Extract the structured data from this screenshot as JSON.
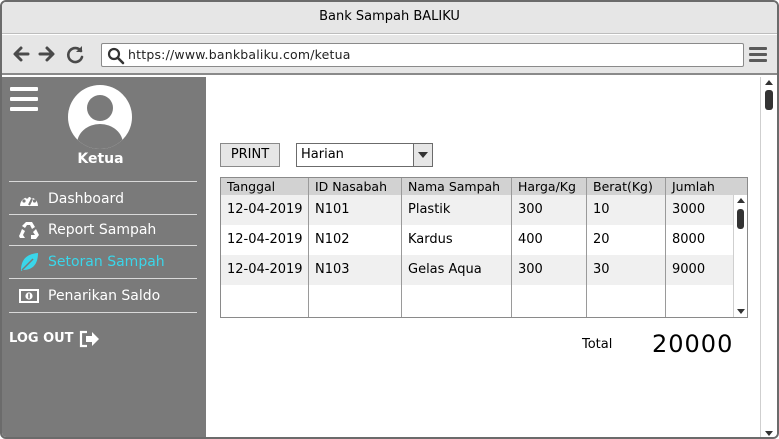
{
  "window": {
    "title": "Bank Sampah BALIKU"
  },
  "browser": {
    "url": "https://www.bankbaliku.com/ketua",
    "back_icon": "arrow-left-icon",
    "forward_icon": "arrow-right-icon",
    "reload_icon": "reload-icon",
    "search_icon": "search-icon",
    "menu_icon": "hamburger-icon"
  },
  "sidebar": {
    "role": "Ketua",
    "items": [
      {
        "label": "Dashboard",
        "icon": "gauge-icon",
        "active": false
      },
      {
        "label": "Report Sampah",
        "icon": "recycle-icon",
        "active": false
      },
      {
        "label": "Setoran Sampah",
        "icon": "leaf-icon",
        "active": true
      },
      {
        "label": "Penarikan Saldo",
        "icon": "money-icon",
        "active": false
      }
    ],
    "logout": "LOG OUT",
    "active_color": "#3ad6ea"
  },
  "toolbar": {
    "print_label": "PRINT",
    "period_selected": "Harian"
  },
  "table": {
    "columns": [
      "Tanggal",
      "ID Nasabah",
      "Nama Sampah",
      "Harga/Kg",
      "Berat(Kg)",
      "Jumlah"
    ],
    "rows": [
      [
        "12-04-2019",
        "N101",
        "Plastik",
        "300",
        "10",
        "3000"
      ],
      [
        "12-04-2019",
        "N102",
        "Kardus",
        "400",
        "20",
        "8000"
      ],
      [
        "12-04-2019",
        "N103",
        "Gelas Aqua",
        "300",
        "30",
        "9000"
      ]
    ]
  },
  "summary": {
    "total_label": "Total",
    "total_value": "20000"
  }
}
